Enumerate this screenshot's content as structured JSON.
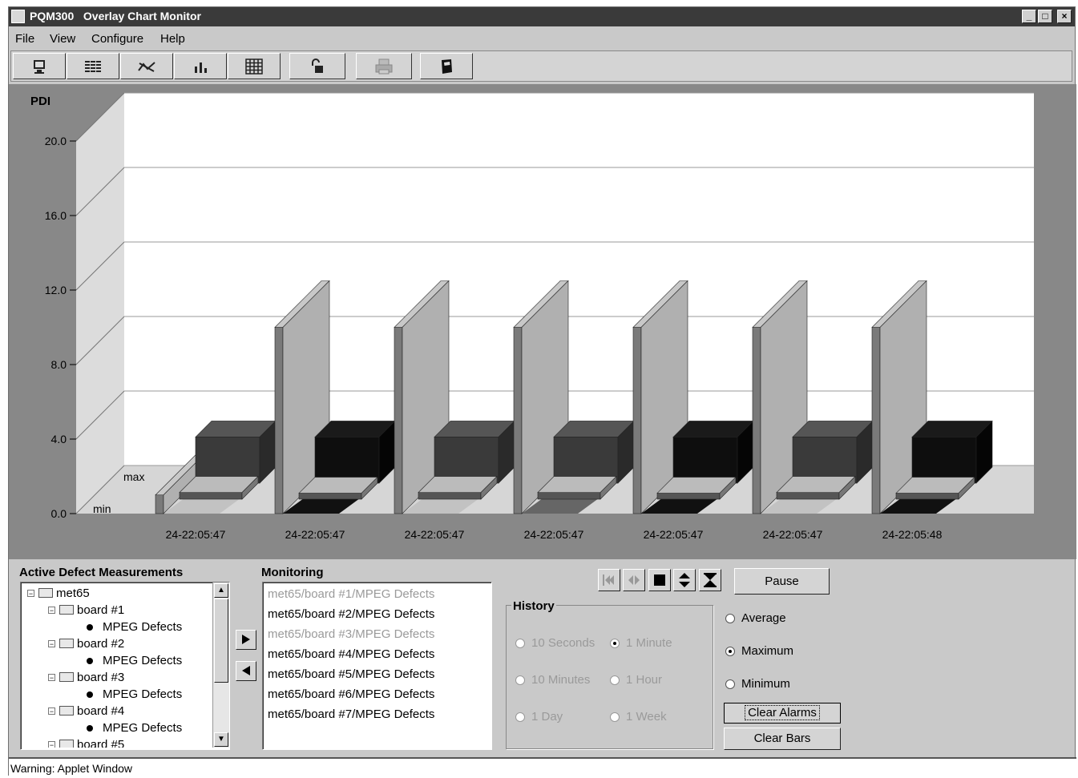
{
  "window": {
    "title": "PQM300   Overlay Chart Monitor",
    "controls": [
      "_",
      "□",
      "×"
    ]
  },
  "menu": [
    "File",
    "View",
    "Configure",
    "Help"
  ],
  "toolbar": {
    "icons": [
      "monitor-icon",
      "grid-list-icon",
      "network-icon",
      "bar-chart-icon",
      "table-icon",
      "unlock-icon",
      "printer-icon",
      "book-icon"
    ]
  },
  "chart": {
    "title": "PDI",
    "max_label": "max",
    "min_label": "min"
  },
  "chart_data": {
    "type": "bar",
    "title": "PDI",
    "ylim": [
      0,
      20
    ],
    "yticks": [
      "0.0",
      "4.0",
      "8.0",
      "12.0",
      "16.0",
      "20.0"
    ],
    "categories": [
      "24-22:05:47",
      "24-22:05:47",
      "24-22:05:47",
      "24-22:05:47",
      "24-22:05:47",
      "24-22:05:47",
      "24-22:05:48"
    ],
    "series": [
      {
        "name": "max",
        "values": [
          1.0,
          10.0,
          10.0,
          10.0,
          10.0,
          10.0,
          10.0
        ]
      },
      {
        "name": "min",
        "values": [
          0.9,
          0.8,
          0.9,
          0.9,
          0.8,
          0.9,
          0.8
        ]
      },
      {
        "values": [
          4.5,
          4.5,
          4.5,
          4.5,
          4.5,
          4.5,
          4.5
        ]
      }
    ],
    "grid": true,
    "colors": {
      "back": "#ffffff",
      "floor": "#d6d6d6",
      "wall": "#dcdcdc",
      "max": "#b0b0b0",
      "dark": "#3a3a3a",
      "black": "#101010"
    }
  },
  "defects": {
    "title": "Active Defect Measurements",
    "tree": [
      {
        "label": "met65",
        "level": 0,
        "kind": "folder"
      },
      {
        "label": "board #1",
        "level": 1,
        "kind": "folder"
      },
      {
        "label": "MPEG Defects",
        "level": 2,
        "kind": "leaf"
      },
      {
        "label": "board #2",
        "level": 1,
        "kind": "folder"
      },
      {
        "label": "MPEG Defects",
        "level": 2,
        "kind": "leaf"
      },
      {
        "label": "board #3",
        "level": 1,
        "kind": "folder"
      },
      {
        "label": "MPEG Defects",
        "level": 2,
        "kind": "leaf"
      },
      {
        "label": "board #4",
        "level": 1,
        "kind": "folder"
      },
      {
        "label": "MPEG Defects",
        "level": 2,
        "kind": "leaf"
      },
      {
        "label": "board #5",
        "level": 1,
        "kind": "folder"
      }
    ]
  },
  "monitoring": {
    "title": "Monitoring",
    "items": [
      {
        "label": "met65/board #1/MPEG Defects",
        "dim": true
      },
      {
        "label": "met65/board #2/MPEG Defects",
        "dim": false
      },
      {
        "label": "met65/board #3/MPEG Defects",
        "dim": true
      },
      {
        "label": "met65/board #4/MPEG Defects",
        "dim": false
      },
      {
        "label": "met65/board #5/MPEG Defects",
        "dim": false
      },
      {
        "label": "met65/board #6/MPEG Defects",
        "dim": false
      },
      {
        "label": "met65/board #7/MPEG Defects",
        "dim": false
      }
    ]
  },
  "history": {
    "title": "History",
    "options": [
      {
        "label": "10 Seconds",
        "selected": false
      },
      {
        "label": "1 Minute",
        "selected": true
      },
      {
        "label": "10 Minutes",
        "selected": false
      },
      {
        "label": "1 Hour",
        "selected": false
      },
      {
        "label": "1 Day",
        "selected": false
      },
      {
        "label": "1 Week",
        "selected": false
      }
    ]
  },
  "mode": {
    "options": [
      {
        "label": "Average",
        "selected": false
      },
      {
        "label": "Maximum",
        "selected": true
      },
      {
        "label": "Minimum",
        "selected": false
      }
    ]
  },
  "buttons": {
    "pause": "Pause",
    "clear_alarms": "Clear Alarms",
    "clear_bars": "Clear Bars"
  },
  "status": "Warning: Applet Window"
}
